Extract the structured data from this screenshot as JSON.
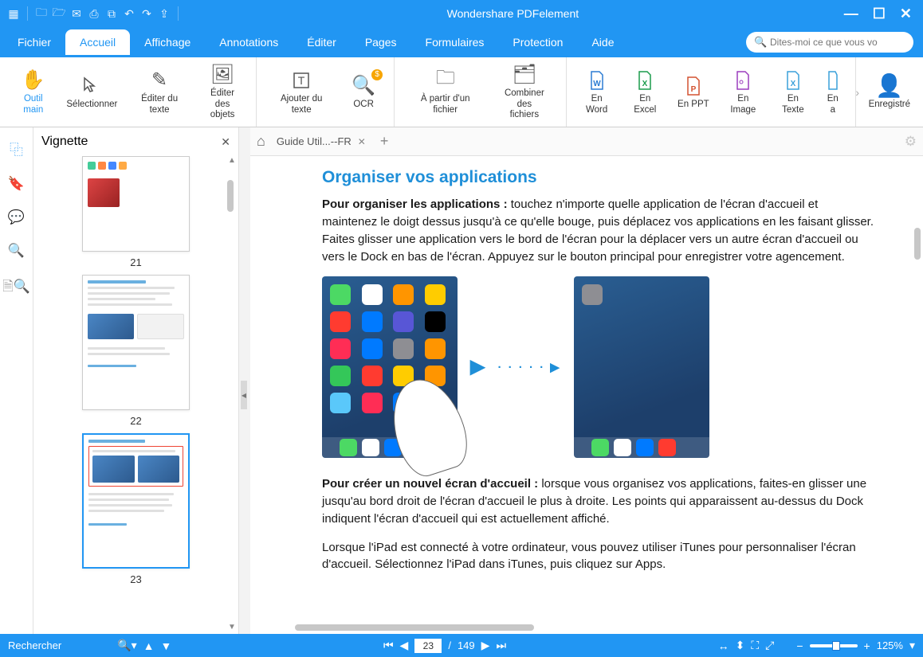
{
  "app": {
    "title": "Wondershare PDFelement"
  },
  "quickAccess": {
    "icons": [
      "app-logo",
      "open-icon",
      "folder-icon",
      "mail-icon",
      "print-icon",
      "screenshot-icon",
      "undo-icon",
      "redo-icon",
      "share-icon"
    ]
  },
  "menu": {
    "items": [
      "Fichier",
      "Accueil",
      "Affichage",
      "Annotations",
      "Éditer",
      "Pages",
      "Formulaires",
      "Protection",
      "Aide"
    ],
    "activeIndex": 1
  },
  "search": {
    "placeholder": "Dites-moi ce que vous vo"
  },
  "ribbon": {
    "groups": [
      [
        {
          "label": "Outil main",
          "icon": "hand-icon",
          "active": true,
          "color": "#2196F3"
        },
        {
          "label": "Sélectionner",
          "icon": "cursor-icon"
        },
        {
          "label": "Éditer du texte",
          "icon": "edit-text-icon"
        },
        {
          "label": "Éditer\ndes objets",
          "icon": "edit-object-icon"
        }
      ],
      [
        {
          "label": "Ajouter du texte",
          "icon": "add-text-icon"
        },
        {
          "label": "OCR",
          "icon": "ocr-icon",
          "badge": "$"
        }
      ],
      [
        {
          "label": "À partir d'un fichier",
          "icon": "from-file-icon"
        },
        {
          "label": "Combiner des\nfichiers",
          "icon": "combine-icon"
        }
      ],
      [
        {
          "label": "En Word",
          "icon": "word-icon",
          "iconColor": "#2b7cd3"
        },
        {
          "label": "En Excel",
          "icon": "excel-icon",
          "iconColor": "#1a9b4b"
        },
        {
          "label": "En PPT",
          "icon": "ppt-icon",
          "iconColor": "#d35230"
        },
        {
          "label": "En Image",
          "icon": "image-icon",
          "iconColor": "#9b3dbd"
        },
        {
          "label": "En Texte",
          "icon": "text-icon",
          "iconColor": "#3aa0da"
        },
        {
          "label": "En a",
          "icon": "more-icon",
          "iconColor": "#3aa0da"
        }
      ],
      [
        {
          "label": "Enregistré",
          "icon": "user-icon",
          "iconColor": "#b7cde6"
        }
      ]
    ]
  },
  "leftRail": {
    "items": [
      {
        "name": "thumbnails-icon",
        "active": true
      },
      {
        "name": "bookmark-icon"
      },
      {
        "name": "comment-icon"
      },
      {
        "name": "search-icon"
      },
      {
        "name": "search-file-icon"
      }
    ]
  },
  "sidebar": {
    "title": "Vignette",
    "thumbnails": [
      {
        "page": "21"
      },
      {
        "page": "22"
      },
      {
        "page": "23",
        "selected": true
      }
    ]
  },
  "tabs": {
    "fileTab": "Guide Util...--FR"
  },
  "document": {
    "heading": "Organiser vos applications",
    "para1_b": "Pour organiser les applications : ",
    "para1": "touchez n'importe quelle application de l'écran d'accueil et maintenez le doigt dessus jusqu'à ce qu'elle bouge, puis déplacez vos applications en les faisant glisser. Faites glisser une application vers le bord de l'écran pour la déplacer vers un autre écran d'accueil ou vers le Dock en bas de l'écran. Appuyez sur le bouton principal pour enregistrer votre agencement.",
    "para2_b": "Pour créer un nouvel écran d'accueil : ",
    "para2": "lorsque vous organisez vos applications, faites-en glisser une jusqu'au bord droit de l'écran d'accueil le plus à droite. Les points qui apparaissent au-dessus du Dock indiquent l'écran d'accueil qui est actuellement affiché.",
    "para3": "Lorsque l'iPad est connecté à votre ordinateur, vous pouvez utiliser iTunes pour personnaliser l'écran d'accueil. Sélectionnez l'iPad dans iTunes, puis cliquez sur Apps."
  },
  "statusbar": {
    "searchLabel": "Rechercher",
    "currentPage": "23",
    "totalPages": "149",
    "zoom": "125%"
  },
  "colors": {
    "accent": "#2196F3",
    "headingBlue": "#1f8fd8"
  }
}
